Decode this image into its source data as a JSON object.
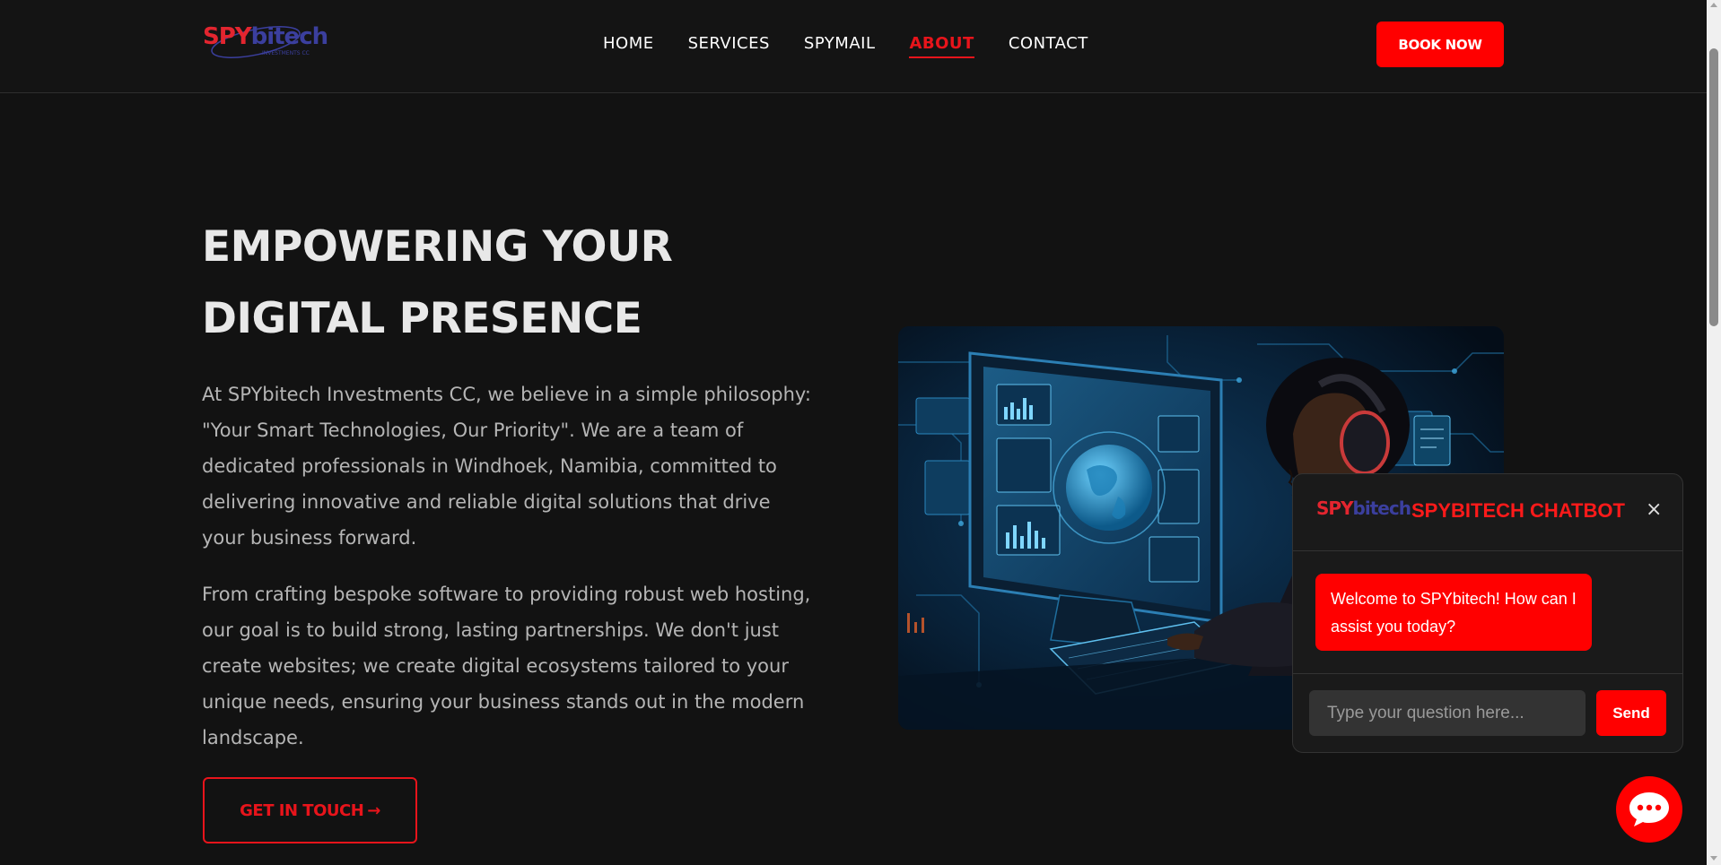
{
  "header": {
    "logo": {
      "spy": "SPY",
      "bitech": "bitech",
      "sub": "INVESTMENTS CC"
    },
    "nav": [
      {
        "label": "HOME"
      },
      {
        "label": "SERVICES"
      },
      {
        "label": "SPYMAIL"
      },
      {
        "label": "ABOUT",
        "active": true
      },
      {
        "label": "CONTACT"
      }
    ],
    "book_label": "BOOK NOW"
  },
  "hero": {
    "title_line1": "EMPOWERING YOUR",
    "title_line2": "DIGITAL PRESENCE",
    "paragraph1": "At SPYbitech Investments CC, we believe in a simple philosophy: \"Your Smart Technologies, Our Priority\". We are a team of dedicated professionals in Windhoek, Namibia, committed to delivering innovative and reliable digital solutions that drive your business forward.",
    "paragraph2": "From crafting bespoke software to providing robust web hosting, our goal is to build strong, lasting partnerships. We don't just create websites; we create digital ecosystems tailored to your unique needs, ensuring your business stands out in the modern landscape.",
    "cta_label": "GET IN TOUCH",
    "cta_arrow": "→",
    "image_icon": "woman-at-computer-illustration"
  },
  "chatbot": {
    "logo_spy": "SPY",
    "logo_bitech": "bitech",
    "title": "SPYBITECH CHATBOT",
    "close_glyph": "×",
    "welcome": "Welcome to SPYbitech! How can I assist you today?",
    "input_placeholder": "Type your question here...",
    "send_label": "Send",
    "fab_icon": "chat-bubble-icon"
  },
  "colors": {
    "accent": "#ff0000",
    "background": "#121212",
    "text": "#e8e8e8",
    "muted": "#b5b5b5"
  }
}
